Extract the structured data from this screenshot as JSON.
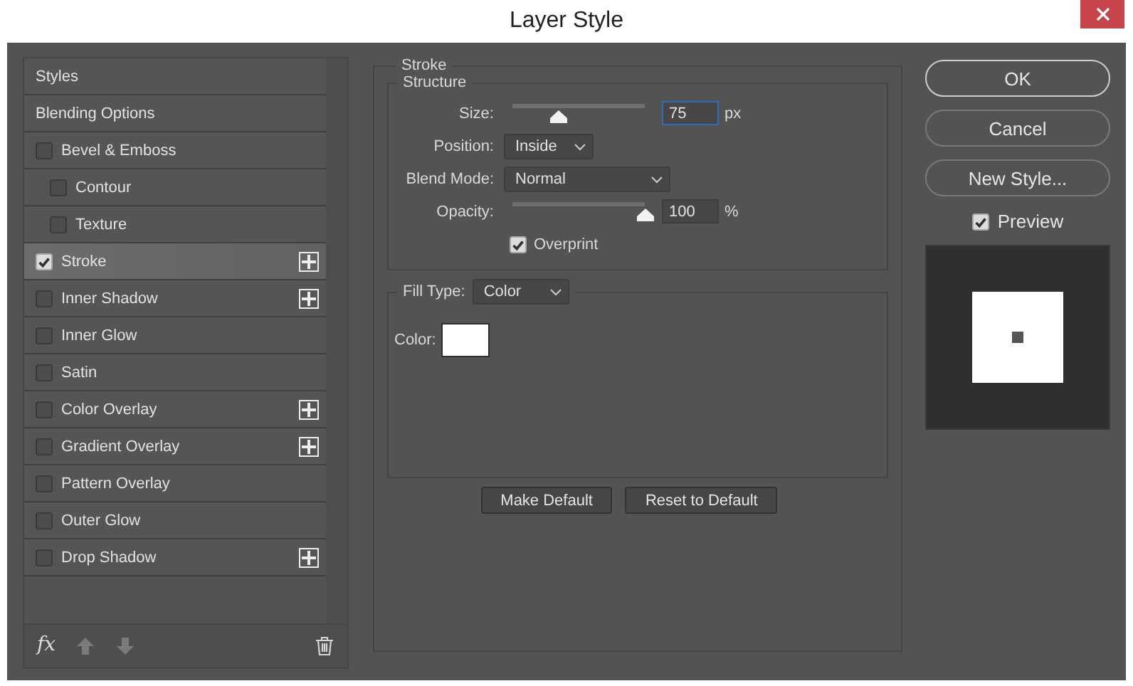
{
  "window": {
    "title": "Layer Style"
  },
  "styles": {
    "items": [
      {
        "label": "Styles",
        "kind": "header",
        "selected": false
      },
      {
        "label": "Blending Options",
        "kind": "header",
        "selected": false
      },
      {
        "label": "Bevel & Emboss",
        "kind": "effect",
        "checked": false,
        "selected": false,
        "addable": false,
        "children": [
          {
            "label": "Contour",
            "kind": "effect",
            "checked": false,
            "selected": false,
            "addable": false
          },
          {
            "label": "Texture",
            "kind": "effect",
            "checked": false,
            "selected": false,
            "addable": false
          }
        ]
      },
      {
        "label": "Stroke",
        "kind": "effect",
        "checked": true,
        "selected": true,
        "addable": true
      },
      {
        "label": "Inner Shadow",
        "kind": "effect",
        "checked": false,
        "selected": false,
        "addable": true
      },
      {
        "label": "Inner Glow",
        "kind": "effect",
        "checked": false,
        "selected": false,
        "addable": false
      },
      {
        "label": "Satin",
        "kind": "effect",
        "checked": false,
        "selected": false,
        "addable": false
      },
      {
        "label": "Color Overlay",
        "kind": "effect",
        "checked": false,
        "selected": false,
        "addable": true
      },
      {
        "label": "Gradient Overlay",
        "kind": "effect",
        "checked": false,
        "selected": false,
        "addable": true
      },
      {
        "label": "Pattern Overlay",
        "kind": "effect",
        "checked": false,
        "selected": false,
        "addable": false
      },
      {
        "label": "Outer Glow",
        "kind": "effect",
        "checked": false,
        "selected": false,
        "addable": false
      },
      {
        "label": "Drop Shadow",
        "kind": "effect",
        "checked": false,
        "selected": false,
        "addable": true
      }
    ],
    "effects_menu": "fx"
  },
  "stroke": {
    "title": "Stroke",
    "structure": {
      "title": "Structure",
      "size": {
        "label": "Size:",
        "level": 0.34,
        "value": "75",
        "unit": "px",
        "focused": true
      },
      "position": {
        "label": "Position:",
        "value": "Inside"
      },
      "blend_mode": {
        "label": "Blend Mode:",
        "value": "Normal"
      },
      "opacity": {
        "label": "Opacity:",
        "level": 1,
        "value": "100",
        "unit": "%",
        "focused": false
      },
      "overprint": {
        "label": "Overprint",
        "checked": true
      }
    },
    "fill": {
      "label": "Fill Type:",
      "value": "Color",
      "color_label": "Color:",
      "color": "#ffffff"
    },
    "buttons": [
      "Make Default",
      "Reset to Default"
    ]
  },
  "actions": [
    {
      "label": "OK",
      "default": true
    },
    {
      "label": "Cancel",
      "default": false
    },
    {
      "label": "New Style...",
      "default": false
    }
  ],
  "preview": {
    "label": "Preview",
    "checked": true
  }
}
